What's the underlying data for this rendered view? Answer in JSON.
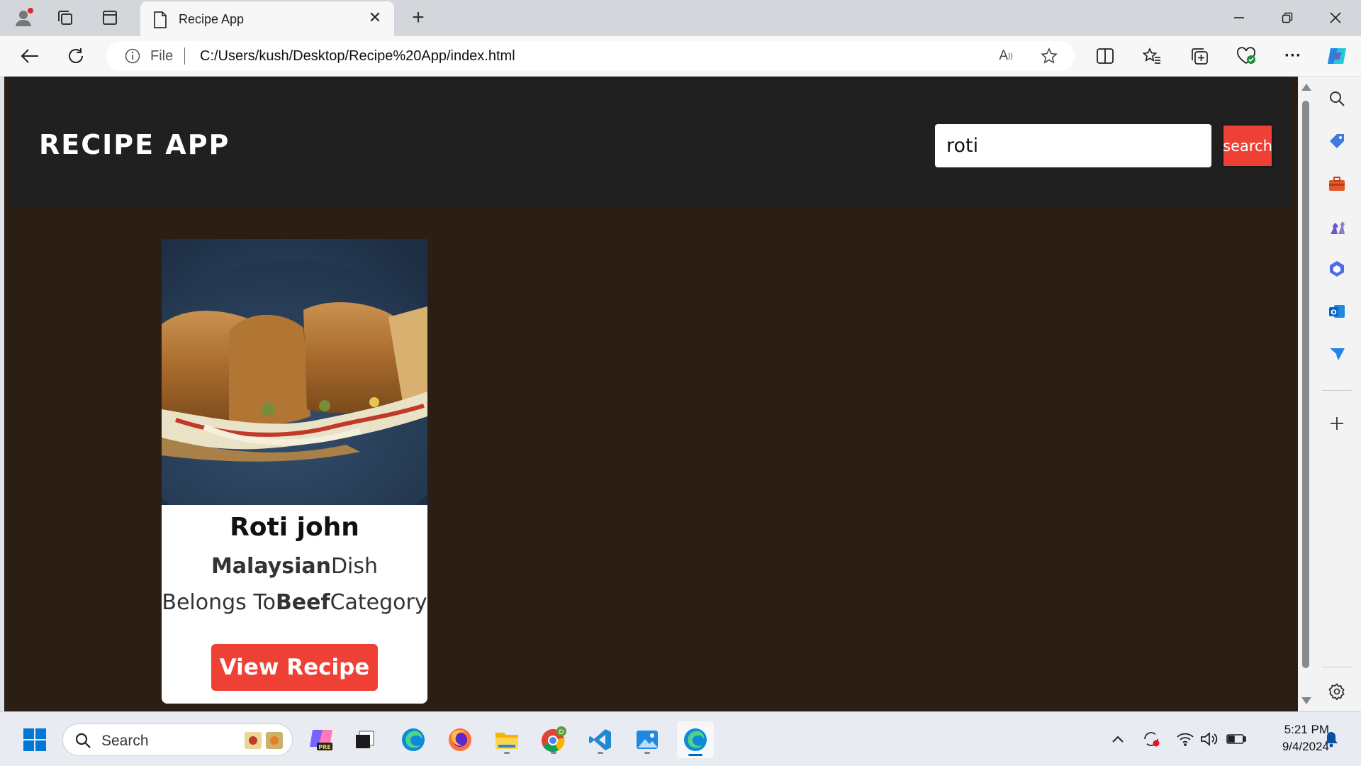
{
  "browser": {
    "tab_title": "Recipe App",
    "address_prefix": "File",
    "url": "C:/Users/kush/Desktop/Recipe%20App/index.html"
  },
  "app": {
    "title": "RECIPE APP",
    "search_value": "roti",
    "search_button": "search"
  },
  "recipes": [
    {
      "name": "Roti john",
      "area": "Malaysian",
      "area_suffix": "Dish",
      "category_prefix": "Belongs To",
      "category": "Beef",
      "category_suffix": "Category",
      "button": "View Recipe"
    }
  ],
  "taskbar": {
    "search_label": "Search",
    "time": "5:21 PM",
    "date": "9/4/2024"
  },
  "colors": {
    "accent_red": "#ef4036",
    "header_bg": "#202020",
    "page_bg": "#2b1e14"
  }
}
